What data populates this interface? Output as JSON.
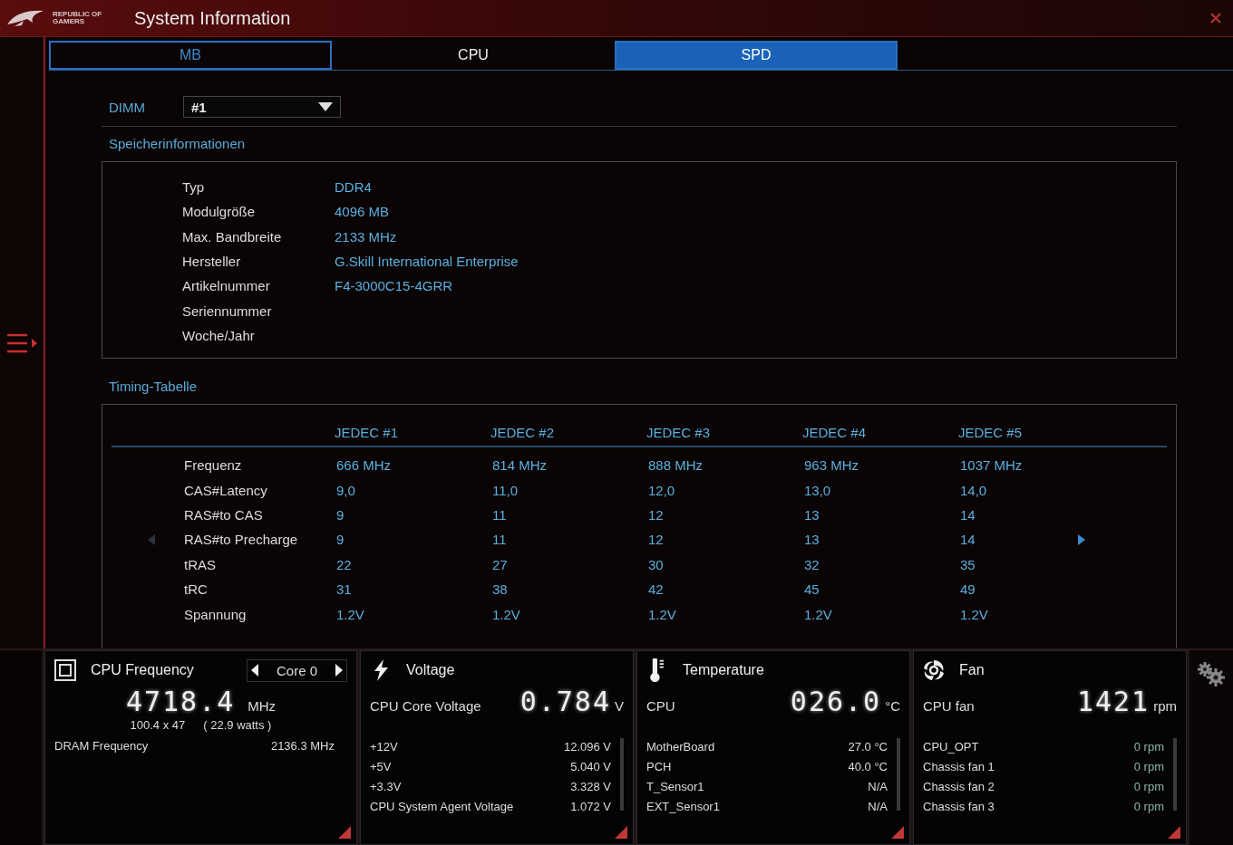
{
  "window": {
    "brand": "REPUBLIC OF GAMERS",
    "title": "System Information"
  },
  "tabs": [
    {
      "label": "MB",
      "selected": false,
      "focused": true
    },
    {
      "label": "CPU",
      "selected": false,
      "focused": false
    },
    {
      "label": "SPD",
      "selected": true,
      "focused": false
    }
  ],
  "dimm": {
    "label": "DIMM",
    "value": "#1"
  },
  "module_info": {
    "title": "Speicherinformationen",
    "rows": [
      {
        "label": "Typ",
        "value": "DDR4"
      },
      {
        "label": "Modulgröße",
        "value": "4096 MB"
      },
      {
        "label": "Max. Bandbreite",
        "value": "2133 MHz"
      },
      {
        "label": "Hersteller",
        "value": "G.Skill International Enterprise"
      },
      {
        "label": "Artikelnummer",
        "value": "F4-3000C15-4GRR"
      },
      {
        "label": "Seriennummer",
        "value": ""
      },
      {
        "label": "Woche/Jahr",
        "value": ""
      }
    ]
  },
  "timing": {
    "title": "Timing-Tabelle",
    "columns": [
      "JEDEC #1",
      "JEDEC #2",
      "JEDEC #3",
      "JEDEC #4",
      "JEDEC #5"
    ],
    "prev_enabled": false,
    "next_enabled": true,
    "rows": [
      {
        "label": "Frequenz",
        "values": [
          "666 MHz",
          "814 MHz",
          "888 MHz",
          "963 MHz",
          "1037 MHz"
        ]
      },
      {
        "label": "CAS#Latency",
        "values": [
          "9,0",
          "11,0",
          "12,0",
          "13,0",
          "14,0"
        ]
      },
      {
        "label": "RAS#to CAS",
        "values": [
          "9",
          "11",
          "12",
          "13",
          "14"
        ]
      },
      {
        "label": "RAS#to Precharge",
        "values": [
          "9",
          "11",
          "12",
          "13",
          "14"
        ]
      },
      {
        "label": "tRAS",
        "values": [
          "22",
          "27",
          "30",
          "32",
          "35"
        ]
      },
      {
        "label": "tRC",
        "values": [
          "31",
          "38",
          "42",
          "45",
          "49"
        ]
      },
      {
        "label": "Spannung",
        "values": [
          "1.2V",
          "1.2V",
          "1.2V",
          "1.2V",
          "1.2V"
        ]
      }
    ]
  },
  "monitor": [
    {
      "kind": "cpu",
      "title": "CPU Frequency",
      "core": "Core 0",
      "big_value": "4718.4",
      "big_unit": "MHz",
      "ratio": "100.4  x  47",
      "power": "( 22.9 watts )",
      "rows": [
        {
          "label": "DRAM Frequency",
          "value": "2136.3  MHz"
        }
      ]
    },
    {
      "kind": "voltage",
      "title": "Voltage",
      "big_label": "CPU Core Voltage",
      "big_value": "0.784",
      "big_unit": "V",
      "rows": [
        {
          "label": "+12V",
          "value": "12.096  V"
        },
        {
          "label": "+5V",
          "value": "5.040  V"
        },
        {
          "label": "+3.3V",
          "value": "3.328  V"
        },
        {
          "label": "CPU System Agent Voltage",
          "value": "1.072  V"
        }
      ]
    },
    {
      "kind": "temperature",
      "title": "Temperature",
      "big_label": "CPU",
      "big_value": "026.0",
      "big_unit": "°C",
      "rows": [
        {
          "label": "MotherBoard",
          "value": "27.0 °C"
        },
        {
          "label": "PCH",
          "value": "40.0 °C"
        },
        {
          "label": "T_Sensor1",
          "value": "N/A"
        },
        {
          "label": "EXT_Sensor1",
          "value": "N/A"
        }
      ]
    },
    {
      "kind": "fan",
      "title": "Fan",
      "big_label": "CPU fan",
      "big_value": "1421",
      "big_unit": "rpm",
      "rows": [
        {
          "label": "CPU_OPT",
          "value": "0  rpm"
        },
        {
          "label": "Chassis fan 1",
          "value": "0  rpm"
        },
        {
          "label": "Chassis fan 2",
          "value": "0  rpm"
        },
        {
          "label": "Chassis fan 3",
          "value": "0  rpm"
        }
      ]
    }
  ]
}
